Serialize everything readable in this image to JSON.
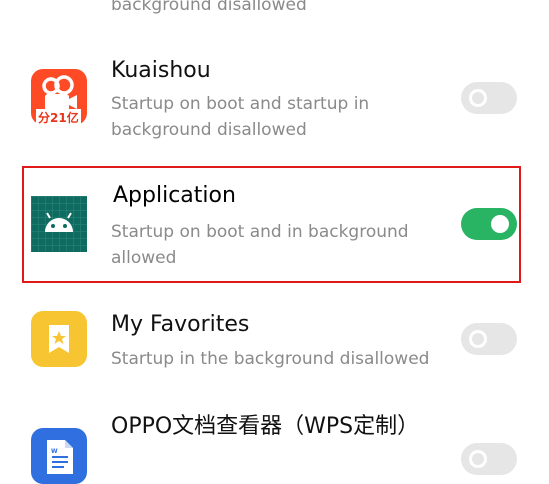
{
  "top_partial": {
    "subtitle": "background disallowed"
  },
  "apps": [
    {
      "name": "Kuaishou",
      "status": "Startup on boot and startup in background disallowed",
      "enabled": false,
      "icon": "kuaishou-icon",
      "icon_text": "分21亿"
    },
    {
      "name": "Application",
      "status": "Startup on boot and in background allowed",
      "enabled": true,
      "icon": "android-icon"
    },
    {
      "name": "My Favorites",
      "status": "Startup in the background disallowed",
      "enabled": false,
      "icon": "favorites-bookmark-icon"
    },
    {
      "name": "OPPO文档查看器（WPS定制）",
      "status": "",
      "enabled": false,
      "icon": "wps-document-icon"
    }
  ],
  "colors": {
    "toggle_on": "#29b463",
    "toggle_off": "#e6e6e6",
    "highlight": "#e01919"
  }
}
